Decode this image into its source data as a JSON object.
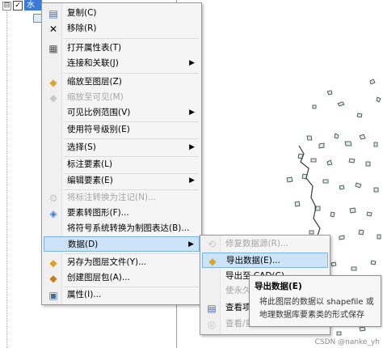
{
  "toc": {
    "expander_glyph": "⊟",
    "check_glyph": "✓",
    "layer_name": "水域"
  },
  "context_menu": {
    "items": [
      {
        "label": "复制(C)",
        "icon": "copy-icon",
        "glyph": "▤"
      },
      {
        "label": "移除(R)",
        "icon": "remove-icon",
        "glyph": "✕"
      },
      {
        "label": "打开属性表(T)",
        "icon": "table-icon",
        "glyph": "▦"
      },
      {
        "label": "连接和关联(J)",
        "arrow": "▶"
      },
      {
        "label": "缩放至图层(Z)",
        "icon": "zoom-layer-icon",
        "glyph": "◆"
      },
      {
        "label": "缩放至可见(M)",
        "icon": "zoom-visible-icon",
        "glyph": "◆"
      },
      {
        "label": "可见比例范围(V)",
        "arrow": "▶"
      },
      {
        "label": "使用符号级别(E)"
      },
      {
        "label": "选择(S)",
        "arrow": "▶"
      },
      {
        "label": "标注要素(L)"
      },
      {
        "label": "编辑要素(E)",
        "arrow": "▶"
      },
      {
        "label": "将标注转换为注记(N)...",
        "icon": "convert-labels-icon",
        "glyph": "⚙"
      },
      {
        "label": "要素转图形(F)...",
        "icon": "features-to-graphics-icon",
        "glyph": "◈"
      },
      {
        "label": "将符号系统转换为制图表达(B)..."
      },
      {
        "label": "数据(D)",
        "arrow": "▶"
      },
      {
        "label": "另存为图层文件(Y)...",
        "icon": "save-layer-icon",
        "glyph": "◆"
      },
      {
        "label": "创建图层包(A)...",
        "icon": "layer-package-icon",
        "glyph": "◆"
      },
      {
        "label": "属性(I)...",
        "icon": "properties-icon",
        "glyph": "▣"
      }
    ]
  },
  "sub_menu": {
    "items": [
      {
        "label": "修复数据源(R)...",
        "icon": "repair-source-icon",
        "glyph": "⟲"
      },
      {
        "label": "导出数据(E)...",
        "icon": "export-data-icon",
        "glyph": "◆"
      },
      {
        "label": "导出至 CAD(C)..."
      },
      {
        "label": "使永久化"
      },
      {
        "label": "查看项目",
        "icon": "view-item-icon",
        "glyph": "▤"
      },
      {
        "label": "查看/重",
        "icon": "view-metadata-icon",
        "glyph": "◎"
      }
    ]
  },
  "tooltip": {
    "title": "导出数据(E)",
    "body": "将此图层的数据以 shapefile 或地理数据库要素类的形式保存"
  },
  "watermark": "CSDN @nanke_yh",
  "colors": {
    "selection_blue": "#3a7bd5",
    "highlight_fill": "#cde3f7",
    "highlight_border": "#7cb2e3"
  }
}
